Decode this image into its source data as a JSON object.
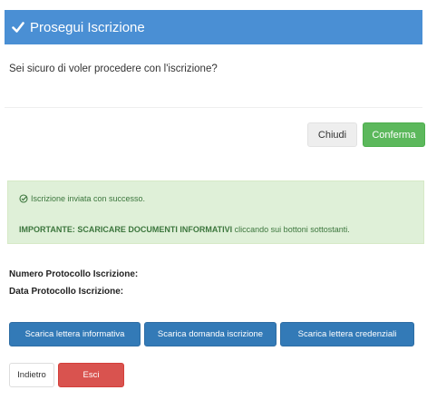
{
  "modal": {
    "title": "Prosegui Iscrizione",
    "message": "Sei sicuro di voler procedere con l'iscrizione?",
    "close_label": "Chiudi",
    "confirm_label": "Conferma"
  },
  "alert": {
    "success_text": "Iscrizione inviata con successo.",
    "important_bold": "IMPORTANTE: SCARICARE DOCUMENTI INFORMATIVI",
    "important_rest": " cliccando sui bottoni sottostanti."
  },
  "info": {
    "protocol_number_label": "Numero Protocollo Iscrizione:",
    "protocol_date_label": "Data Protocollo Iscrizione:"
  },
  "downloads": [
    {
      "label": "Scarica lettera informativa"
    },
    {
      "label": "Scarica domanda iscrizione"
    },
    {
      "label": "Scarica lettera credenziali"
    }
  ],
  "footer": {
    "back_label": "Indietro",
    "exit_label": "Esci"
  },
  "colors": {
    "header": "#4a8fd4",
    "confirm": "#5cb85c",
    "primary": "#337ab7",
    "danger": "#d9534f",
    "alert_bg": "#dff0d8",
    "alert_text": "#3c763d"
  },
  "icons": {
    "header_icon": "check-icon",
    "success_icon": "check-circle-icon"
  }
}
